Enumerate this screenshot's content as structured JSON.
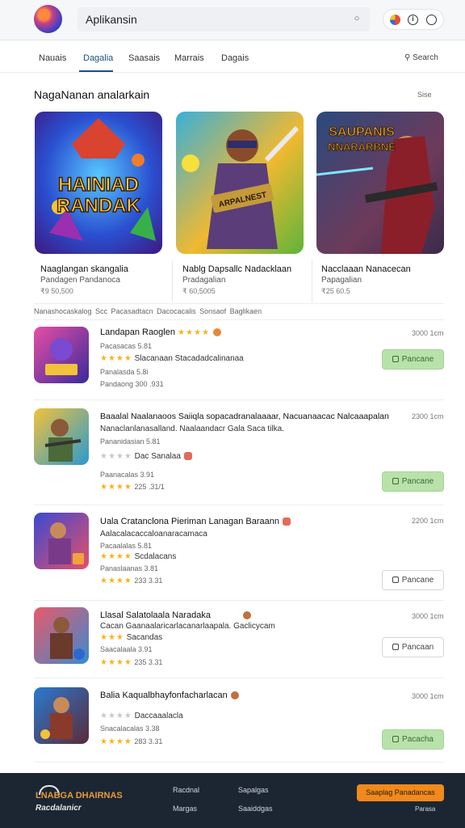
{
  "header": {
    "app_title": "Aplikansin",
    "search_icon": "search-icon",
    "icons": [
      "flag-icon",
      "info-icon",
      "profile-icon"
    ]
  },
  "tabs": {
    "items": [
      "Nauais",
      "Dagalia",
      "Saasais",
      "Marrais",
      "Dagais"
    ],
    "active_index": 1,
    "search_label": "Search"
  },
  "featured": {
    "title": "NagaNanan analarkain",
    "more": "Sise",
    "cards": [
      {
        "art_text": [
          "HAINIAD",
          "RANDAK"
        ],
        "name": "Naaglangan skangalia",
        "sub": "Pandagen Pandanoca",
        "price": "₹9 50,500"
      },
      {
        "art_text": [
          "ARPALNEST"
        ],
        "name": "Nablg Dapsallc Nadacklaan",
        "sub": "Pradagalian",
        "price": "₹ 60,5005"
      },
      {
        "art_text": [
          "SAUPANIS",
          "NNARARBNE"
        ],
        "name": "Nacclaaan Nanacecan",
        "sub": "Papagalian",
        "price": "₹25 60.5"
      }
    ]
  },
  "filter_text": "Nanashocaskalog  Scc Pacasadtacn  Dacocacalis  Sonsaof Baglikaen",
  "list": [
    {
      "title": "Landapan Raoglen",
      "lines": [
        "Pacasacas 5.81",
        "Slacanaan  Stacadadcalinanaa",
        "Panalasda  5.8i",
        "Pandaong  300  .931"
      ],
      "time": "3000 1cm",
      "button": "Pancane",
      "button_style": "green"
    },
    {
      "title": "Baaalal Naalanaoos  Saiiqla  sopacadranalaaaar, Nacuanaacac Nalcaaapalan",
      "lines": [
        "Nanaclanlanasalland. Naalaandacr Gala Saca tilka.",
        "Pananidasian  5.81",
        "Dac Sanalaa",
        "Paanacalas  3.91",
        "225  .31/1"
      ],
      "time": "2300 1cm",
      "button": "Pancane",
      "button_style": "green"
    },
    {
      "title": "Uala Cratanclona Pieriman Lanagan Baraann",
      "lines": [
        "Aalacalacaccaloanaracamaca",
        "Pacaalalas  5.81",
        "Scdalacans",
        "Panaslaanas  3.81",
        "233  3.31"
      ],
      "time": "2200 1cm",
      "button": "Pancane",
      "button_style": "outline"
    },
    {
      "title": "Llasal Salatolaala Naradaka",
      "lines": [
        "Cacan Gaanaalaricarlacanarlaapala. Gaclicycam",
        "Sacandas",
        "Saacalaala  3.91",
        "235  3.31"
      ],
      "time": "3000 1cm",
      "button": "Pancaan",
      "button_style": "outline"
    },
    {
      "title": "Balia Kaqualbhayfonfacharlacan",
      "lines": [
        "Daccaaalacla",
        "Snacalacalas  3.38",
        "283  3.31"
      ],
      "time": "3000 1cm",
      "button": "Pacacha",
      "button_style": "green"
    }
  ],
  "footer": {
    "brand_top": "LNABGA DHAIRNAS",
    "brand_bottom": "Racdalanicr",
    "links": [
      "Racdnal",
      "Sapalgas",
      "Margas",
      "Saaiddgas"
    ],
    "cta": "Saaplag Panadancas",
    "note": "Parasa"
  },
  "colors": {
    "accent": "#1f4f82",
    "install_green": "#b9e2ab",
    "footer_bg": "#1c2633",
    "cta_orange": "#f08a1c",
    "star": "#f5b41f"
  }
}
